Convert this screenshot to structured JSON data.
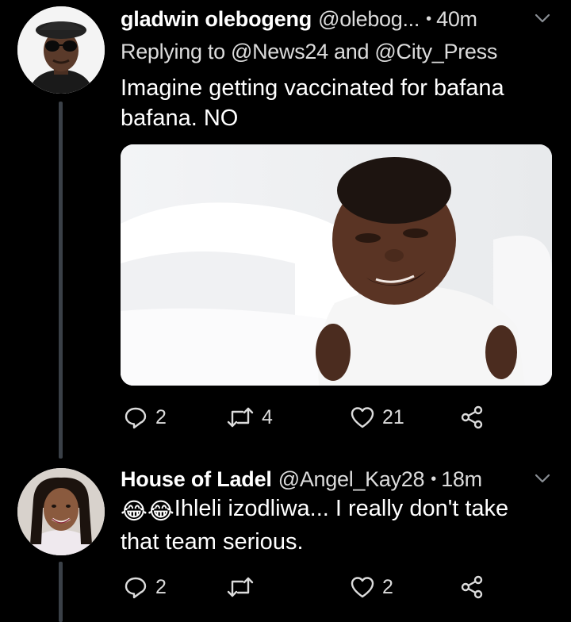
{
  "tweets": [
    {
      "name": "gladwin olebogeng",
      "handle": "@olebog...",
      "time": "40m",
      "reply_prefix": "Replying to",
      "reply_handles": "@News24 and @City_Press",
      "text_line1": "Imagine getting vaccinated for bafana",
      "text_line2": "bafana.  NO",
      "replies": "2",
      "retweets": "4",
      "likes": "21"
    },
    {
      "name": "House of Ladel",
      "handle": "@Angel_Kay28",
      "time": "18m",
      "text_line1": "Ihleli izodliwa... I really don't take",
      "text_line2": "that team serious.",
      "emoji": "😂😂",
      "replies": "2",
      "retweets": "",
      "likes": "2"
    }
  ],
  "colors": {
    "background": "#000000",
    "text": "#ffffff",
    "secondary": "#dcdcdc",
    "thread_line": "#3a4047"
  }
}
